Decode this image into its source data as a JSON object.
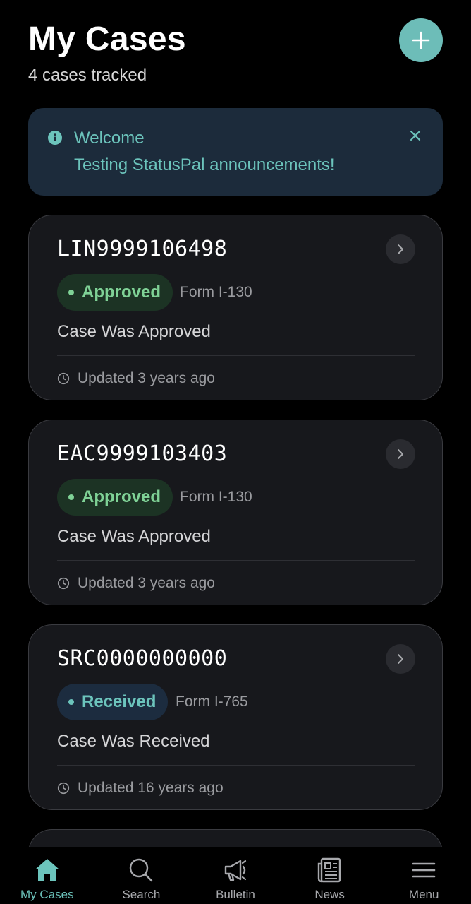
{
  "header": {
    "title": "My Cases",
    "subtitle": "4 cases tracked",
    "add_icon": "plus-icon"
  },
  "announcement": {
    "title": "Welcome",
    "body": "Testing StatusPal announcements!",
    "icon": "info-icon",
    "close_icon": "close-icon"
  },
  "cases": [
    {
      "number": "LIN9999106498",
      "status": "Approved",
      "form": "Form I-130",
      "description": "Case Was Approved",
      "updated": "Updated 3 years ago"
    },
    {
      "number": "EAC9999103403",
      "status": "Approved",
      "form": "Form I-130",
      "description": "Case Was Approved",
      "updated": "Updated 3 years ago"
    },
    {
      "number": "SRC0000000000",
      "status": "Received",
      "form": "Form I-765",
      "description": "Case Was Received",
      "updated": "Updated 16 years ago"
    }
  ],
  "tabs": [
    {
      "label": "My Cases",
      "icon": "home-icon",
      "active": true
    },
    {
      "label": "Search",
      "icon": "search-icon",
      "active": false
    },
    {
      "label": "Bulletin",
      "icon": "megaphone-icon",
      "active": false
    },
    {
      "label": "News",
      "icon": "newspaper-icon",
      "active": false
    },
    {
      "label": "Menu",
      "icon": "menu-icon",
      "active": false
    }
  ],
  "colors": {
    "accent": "#6dbdb8",
    "approved": "#7fd296",
    "received": "#6cc4bc",
    "card_bg": "#17181c",
    "announcement_bg": "#1c2b3b"
  }
}
